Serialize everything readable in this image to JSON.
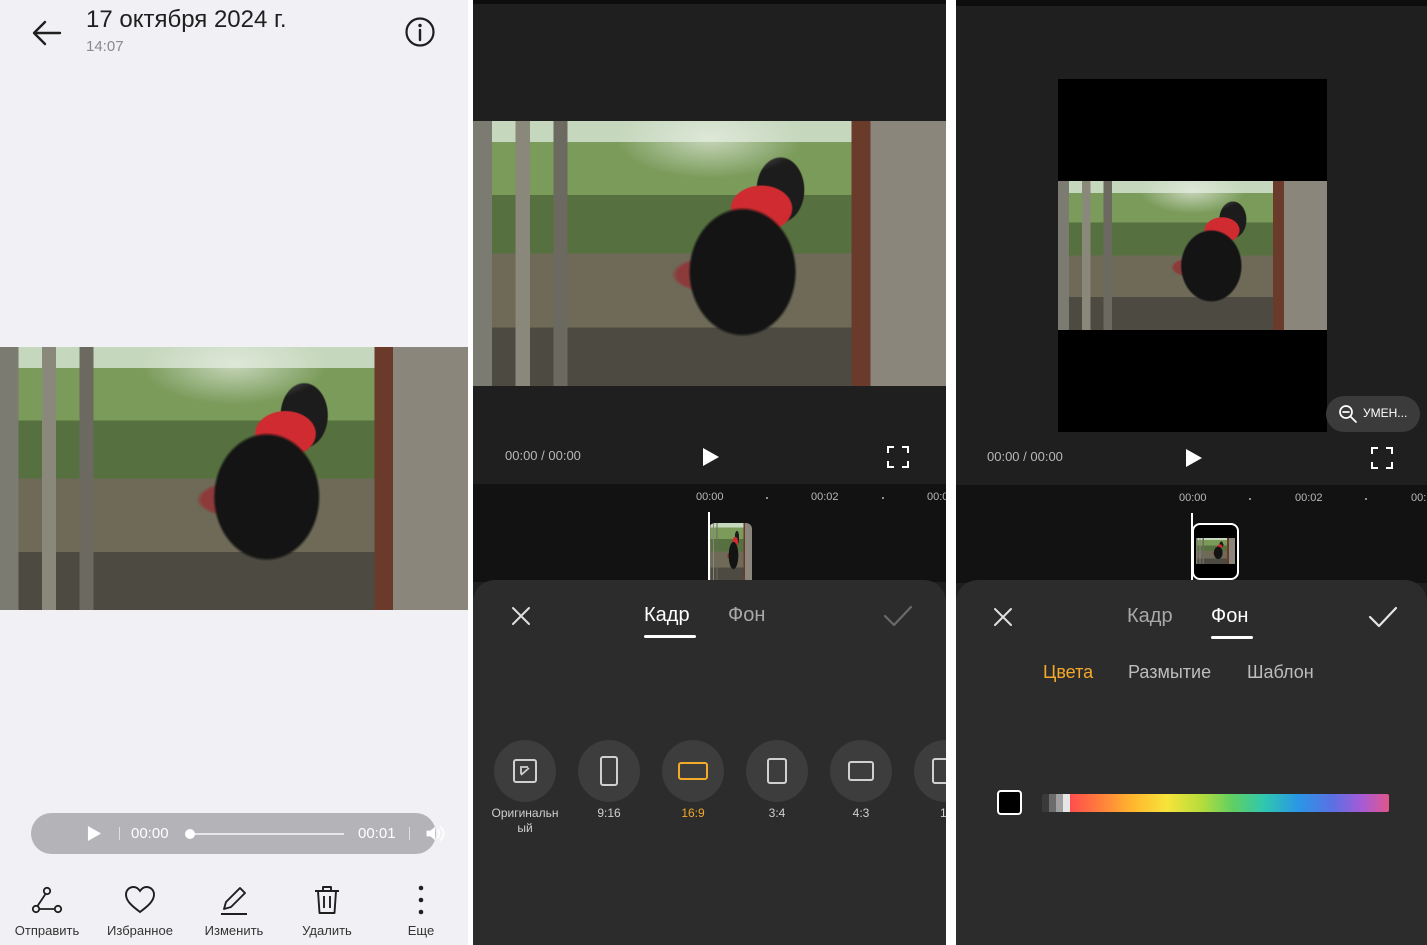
{
  "panel1": {
    "header": {
      "title": "17 октября 2024 г.",
      "time": "14:07",
      "back_icon": "arrow-left-icon",
      "info_icon": "info-icon"
    },
    "player": {
      "current_time": "00:00",
      "total_time": "00:01",
      "progress": 0
    },
    "toolbar": [
      {
        "label": "Отправить",
        "icon": "share-icon"
      },
      {
        "label": "Избранное",
        "icon": "heart-icon"
      },
      {
        "label": "Изменить",
        "icon": "edit-icon"
      },
      {
        "label": "Удалить",
        "icon": "trash-icon"
      },
      {
        "label": "Еще",
        "icon": "more-icon"
      }
    ]
  },
  "panel2": {
    "time_display": "00:00 / 00:00",
    "timeline_ticks": [
      "00:00",
      "00:02",
      "00:0"
    ],
    "tabs": [
      {
        "label": "Кадр",
        "active": true
      },
      {
        "label": "Фон",
        "active": false
      }
    ],
    "ratios": [
      {
        "label": "Оригинальн\nый",
        "selected": false
      },
      {
        "label": "9:16",
        "selected": false
      },
      {
        "label": "16:9",
        "selected": true
      },
      {
        "label": "3:4",
        "selected": false
      },
      {
        "label": "4:3",
        "selected": false
      },
      {
        "label": "1:",
        "selected": false
      }
    ],
    "accent_color": "#f3a92a"
  },
  "panel3": {
    "time_display": "00:00 / 00:00",
    "timeline_ticks": [
      "00:00",
      "00:02",
      "00:"
    ],
    "zoom_label": "УМЕН...",
    "tabs": [
      {
        "label": "Кадр",
        "active": false
      },
      {
        "label": "Фон",
        "active": true
      }
    ],
    "subtabs": [
      {
        "label": "Цвета",
        "active": true
      },
      {
        "label": "Размытие",
        "active": false
      },
      {
        "label": "Шаблон",
        "active": false
      }
    ],
    "accent_color": "#f3a92a"
  }
}
